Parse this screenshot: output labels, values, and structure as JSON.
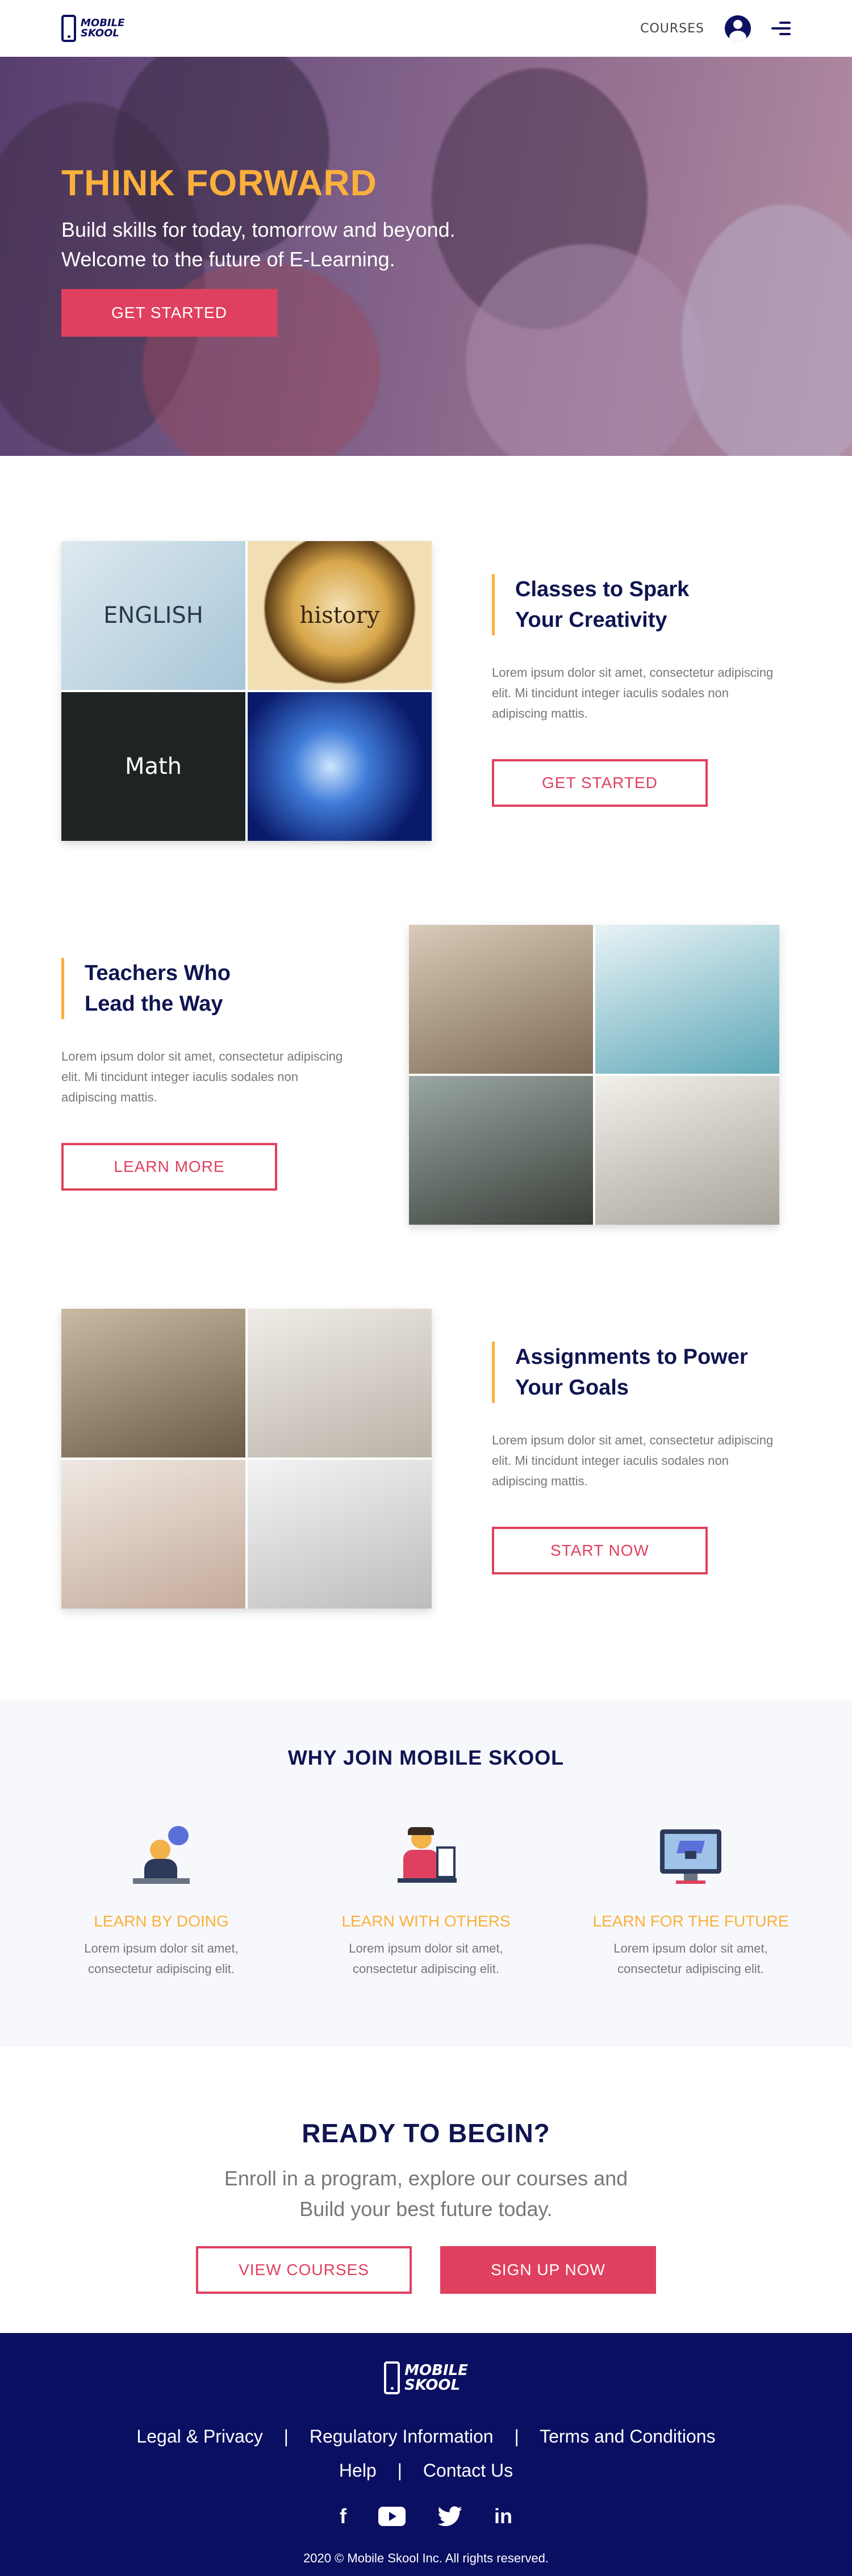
{
  "header": {
    "logo_line1": "MOBILE",
    "logo_line2": "SKOOL",
    "nav_courses": "COURSES"
  },
  "hero": {
    "title": "THINK FORWARD",
    "subtitle_line1": "Build skills for today, tomorrow and beyond.",
    "subtitle_line2": "Welcome to the future of E-Learning.",
    "cta": "GET STARTED"
  },
  "features": [
    {
      "title_line1": "Classes to Spark",
      "title_line2": "Your Creativity",
      "body": "Lorem ipsum dolor sit amet, consectetur adipiscing elit. Mi tincidunt integer iaculis sodales non adipiscing mattis.",
      "cta": "GET STARTED",
      "tiles": [
        "ENGLISH",
        "history",
        "Math",
        ""
      ]
    },
    {
      "title_line1": "Teachers Who",
      "title_line2": "Lead the Way",
      "body": "Lorem ipsum dolor sit amet, consectetur adipiscing elit. Mi tincidunt integer iaculis sodales non adipiscing mattis.",
      "cta": "LEARN MORE",
      "tiles": [
        "",
        "",
        "",
        ""
      ]
    },
    {
      "title_line1": "Assignments to Power",
      "title_line2": "Your Goals",
      "body": "Lorem ipsum dolor sit amet, consectetur adipiscing elit. Mi tincidunt integer iaculis sodales non adipiscing mattis.",
      "cta": "START NOW",
      "tiles": [
        "",
        "",
        "",
        ""
      ]
    }
  ],
  "why": {
    "title": "WHY JOIN MOBILE SKOOL",
    "items": [
      {
        "icon": "person-laptop-icon",
        "heading": "LEARN BY DOING",
        "body": "Lorem ipsum dolor sit amet, consectetur adipiscing elit."
      },
      {
        "icon": "teacher-board-icon",
        "heading": "LEARN WITH OTHERS",
        "body": "Lorem ipsum dolor sit amet, consectetur adipiscing elit."
      },
      {
        "icon": "graduation-monitor-icon",
        "heading": "LEARN FOR THE FUTURE",
        "body": "Lorem ipsum dolor sit amet, consectetur adipiscing elit."
      }
    ]
  },
  "ready": {
    "title": "READY TO BEGIN?",
    "subtitle": "Enroll in a program, explore our courses and Build your best future today.",
    "view_courses": "VIEW COURSES",
    "sign_up": "SIGN UP NOW"
  },
  "footer": {
    "logo_line1": "MOBILE",
    "logo_line2": "SKOOL",
    "links": [
      "Legal & Privacy",
      "Regulatory Information",
      "Terms and Conditions",
      "Help",
      "Contact Us"
    ],
    "social_facebook": "f",
    "social_linkedin": "in",
    "copyright": "2020 © Mobile Skool Inc. All rights reserved."
  },
  "colors": {
    "navy": "#0f1450",
    "footer_navy": "#0b0f62",
    "accent_pink": "#e0405f",
    "accent_orange": "#fbb03b",
    "body_gray": "#777777"
  }
}
